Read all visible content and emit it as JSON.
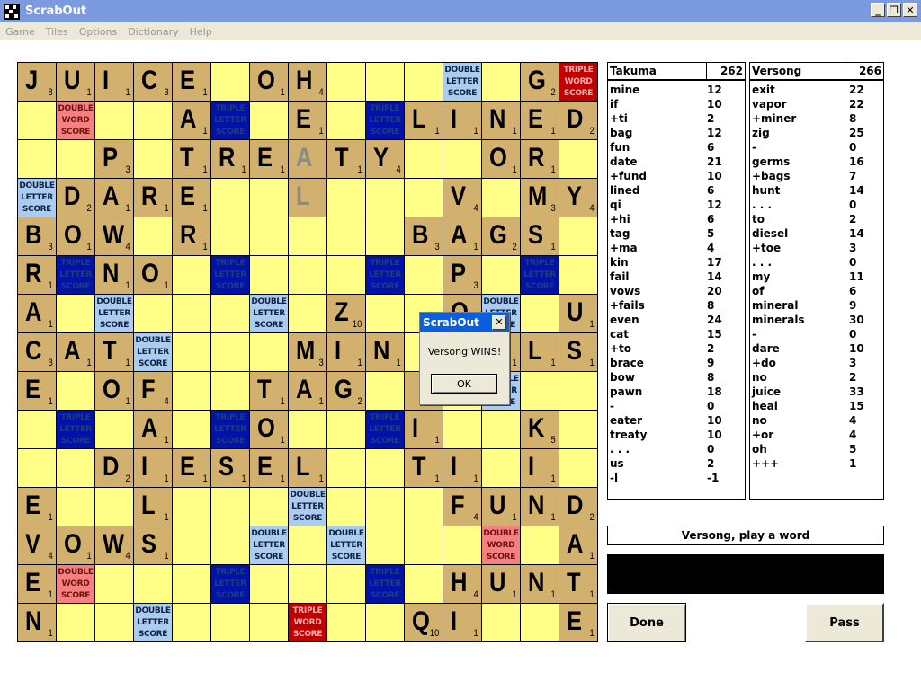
{
  "window": {
    "title": "ScrabOut",
    "controls": [
      "_",
      "❐",
      "✕"
    ]
  },
  "menu": [
    "Game",
    "Tiles",
    "Options",
    "Dictionary",
    "Help"
  ],
  "premium_labels": {
    "DL": [
      "DOUBLE",
      "LETTER",
      "SCORE"
    ],
    "TL": [
      "TRIPLE",
      "LETTER",
      "SCORE"
    ],
    "DW": [
      "DOUBLE",
      "WORD",
      "SCORE"
    ],
    "TW": [
      "TRIPLE",
      "WORD",
      "SCORE"
    ]
  },
  "board": {
    "rows": [
      [
        "J8",
        "U1",
        "I1",
        "C3",
        "E1",
        "",
        "O1",
        "H4",
        "",
        "",
        "",
        "DL",
        "",
        "G2",
        "TW"
      ],
      [
        "",
        "DW",
        "",
        "",
        "A1",
        "TL",
        "",
        "E1",
        "",
        "TL",
        "L1",
        "I1",
        "N1",
        "E1",
        "D2"
      ],
      [
        "",
        "",
        "P3",
        "",
        "T1",
        "R1",
        "E1",
        "a",
        "T1",
        "Y4",
        "",
        "",
        "O1",
        "R1",
        ""
      ],
      [
        "DL",
        "D2",
        "A1",
        "R1",
        "E1",
        "",
        "",
        "l",
        "",
        "",
        "",
        "V4",
        "",
        "M3",
        "Y4"
      ],
      [
        "B3",
        "O1",
        "W4",
        "",
        "R1",
        "",
        "",
        "",
        "",
        "",
        "B3",
        "A1",
        "G2",
        "S1",
        ""
      ],
      [
        "R1",
        "TL",
        "N1",
        "O1",
        "",
        "TL",
        "",
        "",
        "",
        "TL",
        "",
        "P3",
        "",
        "TL",
        ""
      ],
      [
        "A1",
        "",
        "DL",
        "",
        "",
        "",
        "DL",
        "",
        "Z10",
        "",
        "",
        "O1",
        "DL",
        "",
        "U1"
      ],
      [
        "C3",
        "A1",
        "T1",
        "DL",
        "",
        "",
        "",
        "M3",
        "I1",
        "N1",
        "",
        "",
        "?1",
        "L1",
        "S1"
      ],
      [
        "E1",
        "",
        "O1",
        "F4",
        "",
        "",
        "T1",
        "A1",
        "G2",
        "",
        "?1",
        "",
        "DL",
        "",
        ""
      ],
      [
        "",
        "TL",
        "",
        "A1",
        "",
        "TL",
        "O1",
        "",
        "",
        "TL",
        "I1",
        "",
        "",
        "K5",
        ""
      ],
      [
        "",
        "",
        "D2",
        "I1",
        "E1",
        "S1",
        "E1",
        "L1",
        "",
        "",
        "T1",
        "I1",
        "",
        "I1",
        ""
      ],
      [
        "E1",
        "",
        "",
        "L1",
        "",
        "",
        "",
        "DL",
        "",
        "",
        "",
        "F4",
        "U1",
        "N1",
        "D2"
      ],
      [
        "V4",
        "O1",
        "W4",
        "S1",
        "",
        "",
        "DL",
        "",
        "DL",
        "",
        "",
        "",
        "DW",
        "",
        "A1"
      ],
      [
        "E1",
        "DW",
        "",
        "",
        "",
        "TL",
        "",
        "",
        "",
        "TL",
        "",
        "H4",
        "U1",
        "N1",
        "T1"
      ],
      [
        "N1",
        "",
        "",
        "DL",
        "",
        "",
        "",
        "TW",
        "",
        "",
        "Q10",
        "I1",
        "",
        "",
        "E1"
      ]
    ],
    "tentative_tiles_note": "lowercase letters are pending (grey) placements"
  },
  "players": [
    {
      "name": "Takuma",
      "total": "262",
      "moves": [
        [
          "mine",
          "12"
        ],
        [
          "if",
          "10"
        ],
        [
          "+ti",
          "2"
        ],
        [
          "bag",
          "12"
        ],
        [
          "fun",
          "6"
        ],
        [
          "date",
          "21"
        ],
        [
          "+fund",
          "10"
        ],
        [
          "lined",
          "6"
        ],
        [
          "qi",
          "12"
        ],
        [
          "+hi",
          "6"
        ],
        [
          "tag",
          "5"
        ],
        [
          "+ma",
          "4"
        ],
        [
          "kin",
          "17"
        ],
        [
          "fail",
          "14"
        ],
        [
          "vows",
          "20"
        ],
        [
          "+fails",
          "8"
        ],
        [
          "even",
          "24"
        ],
        [
          "cat",
          "15"
        ],
        [
          "+to",
          "2"
        ],
        [
          "brace",
          "9"
        ],
        [
          "bow",
          "8"
        ],
        [
          "pawn",
          "18"
        ],
        [
          "-",
          "0"
        ],
        [
          "eater",
          "10"
        ],
        [
          "treaty",
          "10"
        ],
        [
          ". . .",
          "0"
        ],
        [
          "us",
          "2"
        ],
        [
          "-l",
          "-1"
        ]
      ]
    },
    {
      "name": "Versong",
      "total": "266",
      "moves": [
        [
          "exit",
          "22"
        ],
        [
          "vapor",
          "22"
        ],
        [
          "+miner",
          "8"
        ],
        [
          "zig",
          "25"
        ],
        [
          "-",
          "0"
        ],
        [
          "germs",
          "16"
        ],
        [
          "+bags",
          "7"
        ],
        [
          "hunt",
          "14"
        ],
        [
          ". . .",
          "0"
        ],
        [
          "to",
          "2"
        ],
        [
          "diesel",
          "14"
        ],
        [
          "+toe",
          "3"
        ],
        [
          ". . .",
          "0"
        ],
        [
          "my",
          "11"
        ],
        [
          "of",
          "6"
        ],
        [
          "mineral",
          "9"
        ],
        [
          "minerals",
          "30"
        ],
        [
          "-",
          "0"
        ],
        [
          "dare",
          "10"
        ],
        [
          "+do",
          "3"
        ],
        [
          "no",
          "2"
        ],
        [
          "juice",
          "33"
        ],
        [
          "heal",
          "15"
        ],
        [
          "no",
          "4"
        ],
        [
          "+or",
          "4"
        ],
        [
          "oh",
          "5"
        ],
        [
          "+++",
          "1"
        ]
      ]
    }
  ],
  "prompt": "Versong, play a word",
  "buttons": {
    "done": "Done",
    "pass": "Pass"
  },
  "dialog": {
    "title": "ScrabOut",
    "message": "Versong WINS!",
    "ok": "OK",
    "close": "✕"
  },
  "colors": {
    "tile": "#d2b06e",
    "empty": "#ffff88",
    "double_letter": "#a9ccf0",
    "triple_letter": "#0012a8",
    "double_word": "#f58080",
    "triple_word": "#c00000",
    "titlebar": "#7b9ae0",
    "dialog_title": "#0a5fe0"
  }
}
